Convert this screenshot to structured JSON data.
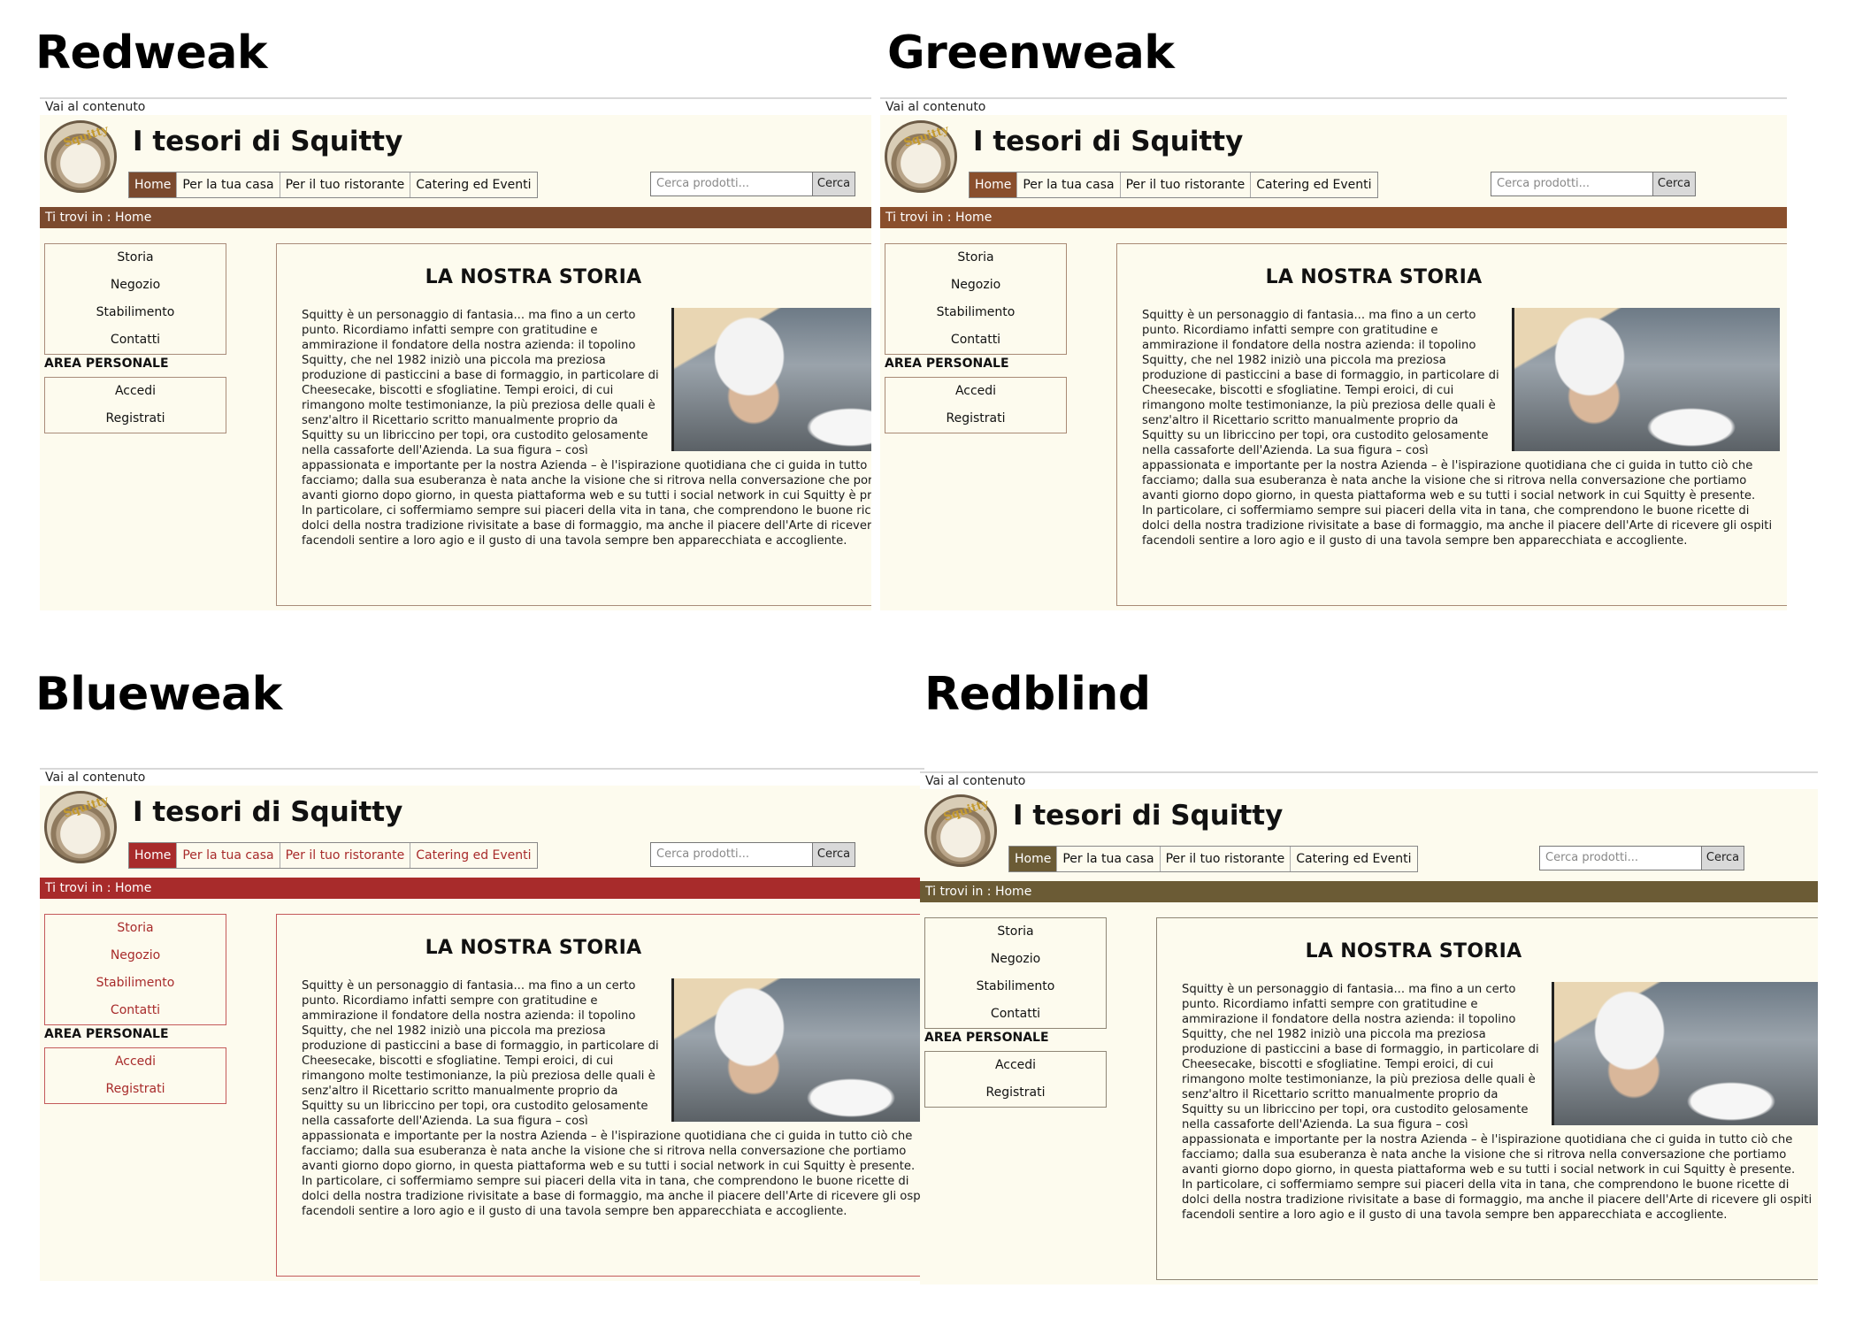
{
  "labels": {
    "redweak": "Redweak",
    "greenweak": "Greenweak",
    "blueweak": "Blueweak",
    "redblind": "Redblind"
  },
  "site": {
    "skip_link": "Vai al contenuto",
    "logo_text": "Squitty",
    "title": "I tesori di Squitty",
    "nav": [
      "Home",
      "Per la tua casa",
      "Per il tuo ristorante",
      "Catering ed Eventi"
    ],
    "search_placeholder": "Cerca prodotti...",
    "search_button": "Cerca",
    "breadcrumb": "Ti trovi in : Home",
    "side_menu": [
      "Storia",
      "Negozio",
      "Stabilimento",
      "Contatti"
    ],
    "area_title": "AREA PERSONALE",
    "area_menu": [
      "Accedi",
      "Registrati"
    ],
    "content_title": "LA NOSTRA STORIA",
    "story_p1": "Squitty è un personaggio di fantasia... ma fino a un certo punto. Ricordiamo infatti sempre con gratitudine e ammirazione il fondatore della nostra azienda: il topolino Squitty, che nel 1982 iniziò una piccola ma preziosa produzione di pasticcini a base di formaggio, in particolare di Cheesecake, biscotti e sfogliatine. Tempi eroici, di cui rimangono molte testimonianze, la più preziosa delle quali è senz'altro il Ricettario scritto manualmente proprio da Squitty su un libriccino per topi, ora custodito gelosamente nella cassaforte dell'Azienda. La sua figura – così appassionata e importante per la nostra Azienda – è l'ispirazione quotidiana che ci guida in tutto ciò che facciamo; dalla sua esuberanza è nata anche la visione che si ritrova nella conversazione che portiamo avanti giorno dopo giorno, in questa piattaforma web e su tutti i social network in cui Squitty è presente.",
    "story_p2": "In particolare, ci soffermiamo sempre sui piaceri della vita in tana, che comprendono le buone ricette di dolci della nostra tradizione rivisitate a base di formaggio, ma anche il piacere dell'Arte di ricevere gli ospiti facendoli sentire a loro agio e il gusto di una tavola sempre ben apparecchiata e accogliente."
  },
  "themes": {
    "redweak": {
      "accent": "#7b4a2e",
      "border": "#a98c7a"
    },
    "greenweak": {
      "accent": "#8a4f2c",
      "border": "#a98a75"
    },
    "blueweak": {
      "accent": "#a82b2b",
      "border": "#c45a5a"
    },
    "redblind": {
      "accent": "#6b5b35",
      "border": "#8f8676"
    }
  }
}
